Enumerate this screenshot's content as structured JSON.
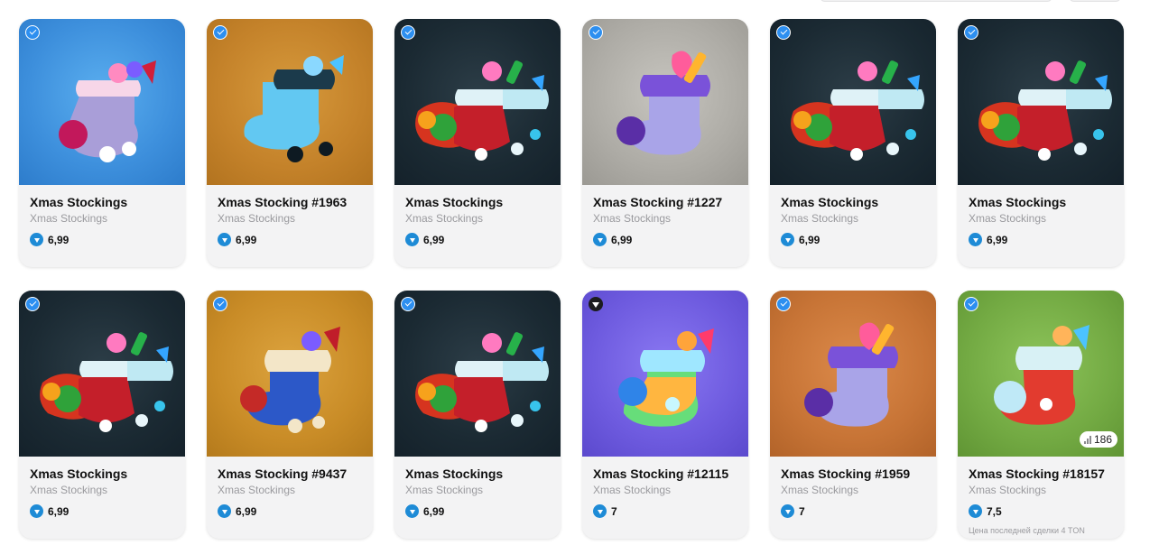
{
  "cards": [
    {
      "title": "Xmas Stockings",
      "subtitle": "Xmas Stockings",
      "price": "6,99",
      "badge": "verified",
      "bg": "blue",
      "art": "pink"
    },
    {
      "title": "Xmas Stocking #1963",
      "subtitle": "Xmas Stockings",
      "price": "6,99",
      "badge": "verified",
      "bg": "orange",
      "art": "ice"
    },
    {
      "title": "Xmas Stockings",
      "subtitle": "Xmas Stockings",
      "price": "6,99",
      "badge": "verified",
      "bg": "dark",
      "art": "group"
    },
    {
      "title": "Xmas Stocking #1227",
      "subtitle": "Xmas Stockings",
      "price": "6,99",
      "badge": "verified",
      "bg": "grey",
      "art": "purple"
    },
    {
      "title": "Xmas Stockings",
      "subtitle": "Xmas Stockings",
      "price": "6,99",
      "badge": "verified",
      "bg": "dark",
      "art": "group"
    },
    {
      "title": "Xmas Stockings",
      "subtitle": "Xmas Stockings",
      "price": "6,99",
      "badge": "verified",
      "bg": "dark",
      "art": "group"
    },
    {
      "title": "Xmas Stockings",
      "subtitle": "Xmas Stockings",
      "price": "6,99",
      "badge": "verified",
      "bg": "dark",
      "art": "group"
    },
    {
      "title": "Xmas Stocking #9437",
      "subtitle": "Xmas Stockings",
      "price": "6,99",
      "badge": "verified",
      "bg": "gold",
      "art": "bluered"
    },
    {
      "title": "Xmas Stockings",
      "subtitle": "Xmas Stockings",
      "price": "6,99",
      "badge": "verified",
      "bg": "dark",
      "art": "group"
    },
    {
      "title": "Xmas Stocking #12115",
      "subtitle": "Xmas Stockings",
      "price": "7",
      "badge": "ton",
      "bg": "purple",
      "art": "rainbow"
    },
    {
      "title": "Xmas Stocking #1959",
      "subtitle": "Xmas Stockings",
      "price": "7",
      "badge": "verified",
      "bg": "copper",
      "art": "purple"
    },
    {
      "title": "Xmas Stocking #18157",
      "subtitle": "Xmas Stockings",
      "price": "7,5",
      "badge": "verified",
      "bg": "green",
      "art": "redwhite",
      "stat": "186",
      "last_deal": "Цена последней сделки 4 TON"
    }
  ],
  "colors": {
    "ton_blue": "#1e8bd6",
    "verified_blue": "#2d8ff0",
    "card_bg": "#f3f3f4"
  }
}
